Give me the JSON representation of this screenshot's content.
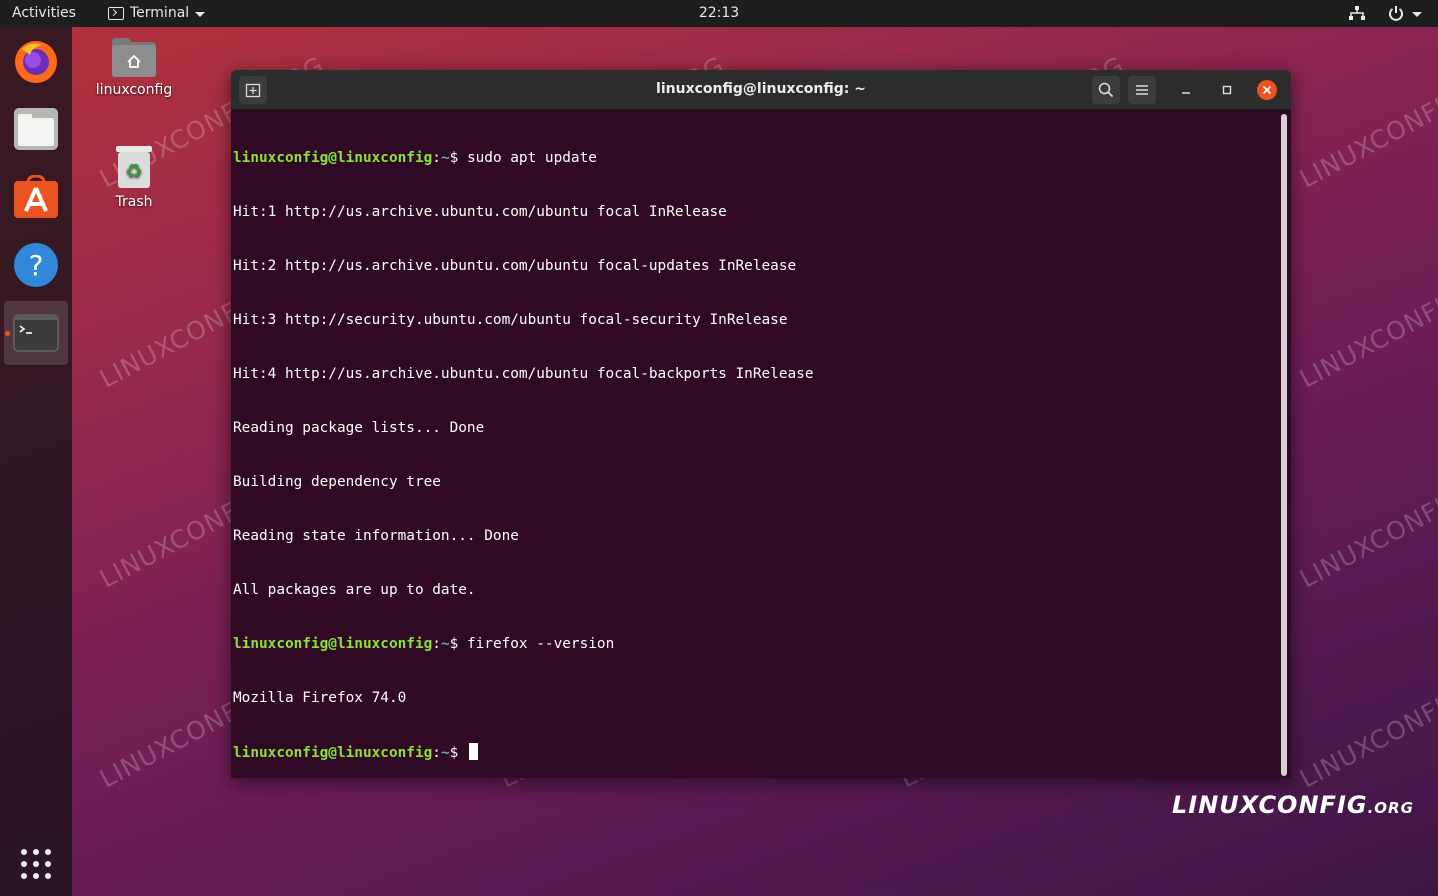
{
  "topbar": {
    "activities": "Activities",
    "app_name": "Terminal",
    "clock": "22:13",
    "network_icon": "network-icon",
    "power_icon": "power-icon"
  },
  "dock": {
    "items": [
      {
        "name": "Firefox",
        "icon": "firefox-icon"
      },
      {
        "name": "Files",
        "icon": "files-icon"
      },
      {
        "name": "Ubuntu Software",
        "icon": "software-icon"
      },
      {
        "name": "Help",
        "icon": "help-icon"
      },
      {
        "name": "Terminal",
        "icon": "terminal-icon",
        "active": true
      }
    ],
    "apps_grid_icon": "show-apps-icon"
  },
  "desktop": {
    "home_folder_label": "linuxconfig",
    "trash_label": "Trash"
  },
  "terminal": {
    "title": "linuxconfig@linuxconfig: ~",
    "prompt_user": "linuxconfig@linuxconfig",
    "prompt_sep": ":",
    "prompt_path": "~",
    "prompt_sym": "$ ",
    "cmd1": "sudo apt update",
    "out": [
      "Hit:1 http://us.archive.ubuntu.com/ubuntu focal InRelease",
      "Hit:2 http://us.archive.ubuntu.com/ubuntu focal-updates InRelease",
      "Hit:3 http://security.ubuntu.com/ubuntu focal-security InRelease",
      "Hit:4 http://us.archive.ubuntu.com/ubuntu focal-backports InRelease",
      "Reading package lists... Done",
      "Building dependency tree",
      "Reading state information... Done",
      "All packages are up to date."
    ],
    "cmd2": "firefox --version",
    "out2": "Mozilla Firefox 74.0",
    "colors": {
      "background": "#300a24",
      "user": "#8ae234",
      "path": "#729fcf",
      "text": "#ffffff"
    }
  },
  "watermark": {
    "text": "LINUXCONFIG.ORG",
    "brand_main": "LINUXCONFIG",
    "brand_suffix": ".ORG"
  },
  "colors": {
    "accent": "#e95420"
  }
}
